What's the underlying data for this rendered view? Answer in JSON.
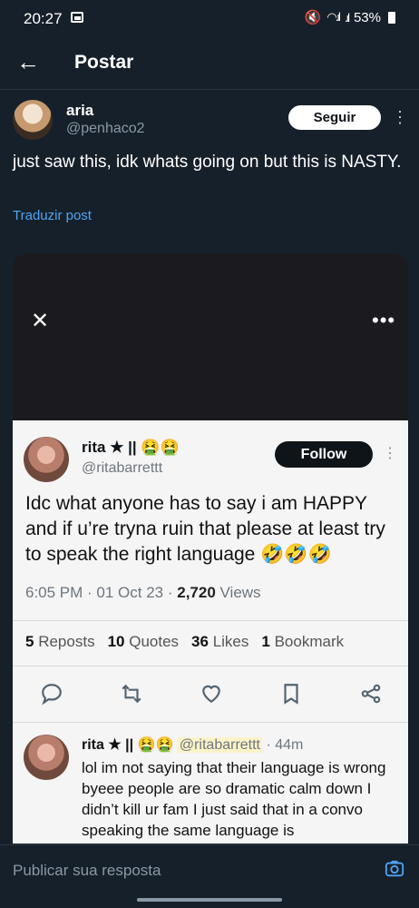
{
  "status_bar": {
    "time": "20:27",
    "battery": "53%"
  },
  "header": {
    "title": "Postar"
  },
  "post": {
    "author_name": "aria",
    "author_handle": "@penhaco2",
    "follow_label": "Seguir",
    "text": "just saw this, idk whats going on but this is NASTY.",
    "translate_label": "Traduzir post"
  },
  "embedded": {
    "name": "rita",
    "name_suffix": "★ || 🤮🤮",
    "handle": "@ritabarrettt",
    "follow_label": "Follow",
    "text": "Idc what anyone has to say i am HAPPY and if u’re tryna ruin that please at least try to speak the right language 🤣🤣🤣",
    "time": "6:05 PM · 01 Oct 23 · ",
    "views_count": "2,720",
    "views_label": " Views",
    "stats": [
      {
        "count": "5",
        "label": "Reposts"
      },
      {
        "count": "10",
        "label": "Quotes"
      },
      {
        "count": "36",
        "label": "Likes"
      },
      {
        "count": "1",
        "label": "Bookmark"
      }
    ],
    "reply": {
      "name": "rita",
      "name_suffix": "★ || 🤮🤮",
      "handle": "@ritabarrettt",
      "age": "· 44m",
      "text": "lol im not saying that their language is wrong byeee people are so dramatic calm down I didn’t kill ur fam I just said that in a convo speaking the same language is"
    }
  },
  "reply_bar": {
    "placeholder": "Publicar sua resposta"
  },
  "colors": {
    "background": "#16202a",
    "link": "#4ea4f3",
    "muted": "#8b98a5"
  }
}
